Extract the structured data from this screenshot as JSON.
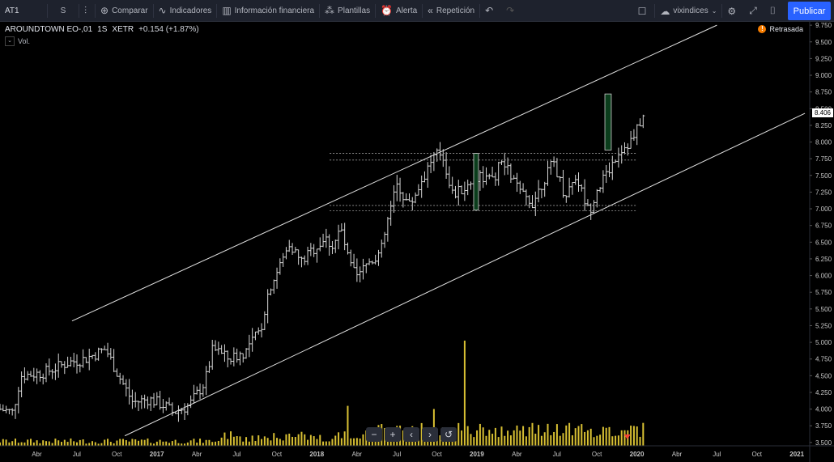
{
  "toolbar": {
    "symbol": "AT1",
    "interval": "S",
    "compare": "Comparar",
    "indicators": "Indicadores",
    "financials": "Información financiera",
    "templates": "Plantillas",
    "alert": "Alerta",
    "replay": "Repetición",
    "layout_name": "vixindices",
    "publish": "Publicar"
  },
  "legend": {
    "name": "AROUNDTOWN EO-,01",
    "interval": "1S",
    "exchange": "XETR",
    "change": "+0.154 (+1.87%)",
    "volume_label": "Vol."
  },
  "status": {
    "delayed": "Retrasada"
  },
  "last_price": "8.406",
  "zoom": {
    "minus": "−",
    "plus": "+",
    "left": "‹",
    "right": "›",
    "reset": "↺"
  },
  "colors": {
    "background": "#000000",
    "toolbar": "#1e222d",
    "publish": "#2962ff",
    "volume": "#d8c033",
    "bars": "#d6d6d6",
    "box": "#0b3d1c"
  },
  "chart_data": {
    "type": "bar",
    "symbol": "AROUNDTOWN EO-,01",
    "y_axis": {
      "ticks": [
        "9.750",
        "9.500",
        "9.250",
        "9.000",
        "8.750",
        "8.500",
        "8.250",
        "8.000",
        "7.750",
        "7.500",
        "7.250",
        "7.000",
        "6.750",
        "6.500",
        "6.250",
        "6.000",
        "5.750",
        "5.500",
        "5.250",
        "5.000",
        "4.750",
        "4.500",
        "4.250",
        "4.000",
        "3.750",
        "3.500"
      ],
      "range": [
        3.45,
        9.8
      ]
    },
    "x_axis": {
      "ticks": [
        {
          "label": "Abr",
          "date": 2016.25
        },
        {
          "label": "Jul",
          "date": 2016.5
        },
        {
          "label": "Oct",
          "date": 2016.75
        },
        {
          "label": "2017",
          "date": 2017.0
        },
        {
          "label": "Abr",
          "date": 2017.25
        },
        {
          "label": "Jul",
          "date": 2017.5
        },
        {
          "label": "Oct",
          "date": 2017.75
        },
        {
          "label": "2018",
          "date": 2018.0
        },
        {
          "label": "Abr",
          "date": 2018.25
        },
        {
          "label": "Jul",
          "date": 2018.5
        },
        {
          "label": "Oct",
          "date": 2018.75
        },
        {
          "label": "2019",
          "date": 2019.0
        },
        {
          "label": "Abr",
          "date": 2019.25
        },
        {
          "label": "Jul",
          "date": 2019.5
        },
        {
          "label": "Oct",
          "date": 2019.75
        },
        {
          "label": "2020",
          "date": 2020.0
        },
        {
          "label": "Abr",
          "date": 2020.25
        },
        {
          "label": "Jul",
          "date": 2020.5
        },
        {
          "label": "Oct",
          "date": 2020.75
        },
        {
          "label": "2021",
          "date": 2021.0
        }
      ],
      "range": [
        2016.02,
        2021.08
      ]
    },
    "price_path": [
      [
        2016.02,
        4.0
      ],
      [
        2016.1,
        3.95
      ],
      [
        2016.15,
        4.5
      ],
      [
        2016.3,
        4.55
      ],
      [
        2016.45,
        4.7
      ],
      [
        2016.55,
        4.75
      ],
      [
        2016.68,
        4.9
      ],
      [
        2016.75,
        4.55
      ],
      [
        2016.85,
        4.1
      ],
      [
        2016.95,
        4.15
      ],
      [
        2017.05,
        4.05
      ],
      [
        2017.1,
        3.95
      ],
      [
        2017.2,
        4.05
      ],
      [
        2017.3,
        4.4
      ],
      [
        2017.35,
        4.9
      ],
      [
        2017.45,
        4.75
      ],
      [
        2017.55,
        4.85
      ],
      [
        2017.65,
        5.2
      ],
      [
        2017.7,
        5.8
      ],
      [
        2017.78,
        6.2
      ],
      [
        2017.83,
        6.5
      ],
      [
        2017.9,
        6.2
      ],
      [
        2017.98,
        6.4
      ],
      [
        2018.05,
        6.55
      ],
      [
        2018.1,
        6.45
      ],
      [
        2018.15,
        6.7
      ],
      [
        2018.2,
        6.2
      ],
      [
        2018.25,
        5.95
      ],
      [
        2018.32,
        6.2
      ],
      [
        2018.4,
        6.35
      ],
      [
        2018.45,
        6.9
      ],
      [
        2018.5,
        7.35
      ],
      [
        2018.58,
        7.05
      ],
      [
        2018.63,
        7.3
      ],
      [
        2018.72,
        7.75
      ],
      [
        2018.78,
        7.85
      ],
      [
        2018.85,
        7.2
      ],
      [
        2018.95,
        7.35
      ],
      [
        2019.02,
        7.5
      ],
      [
        2019.1,
        7.4
      ],
      [
        2019.15,
        7.7
      ],
      [
        2019.2,
        7.55
      ],
      [
        2019.28,
        7.2
      ],
      [
        2019.35,
        7.1
      ],
      [
        2019.42,
        7.45
      ],
      [
        2019.48,
        7.7
      ],
      [
        2019.55,
        7.2
      ],
      [
        2019.62,
        7.5
      ],
      [
        2019.7,
        6.95
      ],
      [
        2019.75,
        7.3
      ],
      [
        2019.82,
        7.55
      ],
      [
        2019.88,
        7.85
      ],
      [
        2019.93,
        7.95
      ],
      [
        2019.98,
        8.05
      ],
      [
        2020.02,
        8.3
      ],
      [
        2020.05,
        8.406
      ]
    ],
    "volume_spikes": [
      {
        "date": 2018.2,
        "value": 0.38
      },
      {
        "date": 2018.73,
        "value": 0.35
      },
      {
        "date": 2018.92,
        "value": 1.0
      },
      {
        "date": 2019.78,
        "value": 0.18
      }
    ],
    "drawings": {
      "upper_channel": [
        [
          2016.47,
          5.32
        ],
        [
          2020.5,
          9.75
        ]
      ],
      "lower_channel": [
        [
          2016.8,
          3.6
        ],
        [
          2021.05,
          8.43
        ]
      ],
      "range_top_lines": [
        7.83,
        7.73
      ],
      "range_bottom_lines": [
        7.05,
        6.97
      ],
      "range_x": [
        2018.08,
        2020.0
      ],
      "boxes": [
        {
          "x": [
            2018.98,
            2019.01
          ],
          "y": [
            6.98,
            7.83
          ]
        },
        {
          "x": [
            2019.8,
            2019.84
          ],
          "y": [
            7.88,
            8.72
          ]
        }
      ]
    }
  }
}
